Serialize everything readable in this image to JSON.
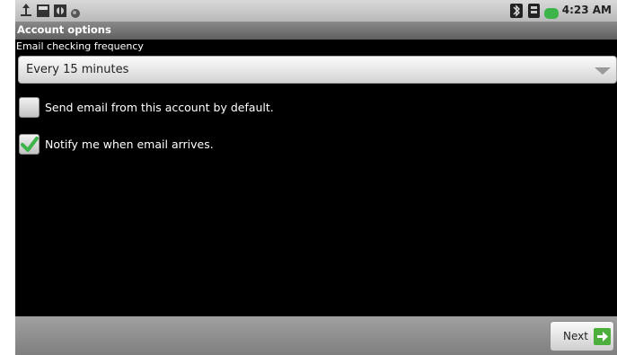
{
  "status_bar": {
    "time": "4:23 AM",
    "icons": [
      "usb-icon",
      "sd-card-icon",
      "debug-icon",
      "notification-dot-icon",
      "bluetooth-icon",
      "signal-icon",
      "battery-icon"
    ]
  },
  "header": {
    "title": "Account options"
  },
  "frequency": {
    "label": "Email checking frequency",
    "selected": "Every 15 minutes"
  },
  "options": [
    {
      "label": "Send email from this account by default.",
      "checked": false
    },
    {
      "label": "Notify me when email arrives.",
      "checked": true
    }
  ],
  "footer": {
    "next_label": "Next"
  },
  "colors": {
    "check_green": "#3cb44a",
    "next_icon_green": "#4caf3c"
  }
}
